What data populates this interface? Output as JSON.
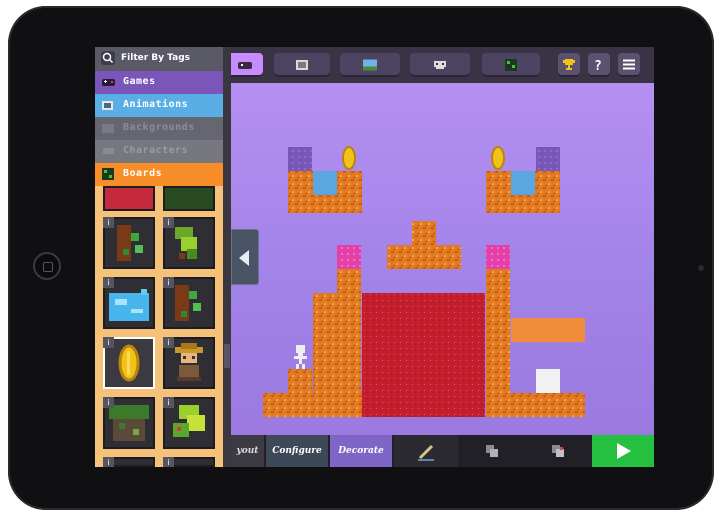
{
  "filter": {
    "label": "Filter By Tags"
  },
  "categories": [
    {
      "label": "Games",
      "icon": "gamepad-icon"
    },
    {
      "label": "Animations",
      "icon": "film-icon"
    },
    {
      "label": "Backgrounds",
      "icon": "landscape-icon"
    },
    {
      "label": "Characters",
      "icon": "character-icon"
    },
    {
      "label": "Boards",
      "icon": "board-icon"
    }
  ],
  "toolbar": {
    "buttons": [
      "games-icon",
      "animations-icon",
      "backgrounds-icon",
      "characters-icon",
      "boards-icon",
      "trophy-icon",
      "help-icon",
      "menu-icon"
    ]
  },
  "bottom_tabs": {
    "layout": "yout",
    "configure": "Configure",
    "decorate": "Decorate"
  },
  "colors": {
    "canvas": "#b68ff2",
    "brick": "#e07a22",
    "lava": "#c4202e",
    "pink": "#e040a8",
    "blue": "#5aa6e0",
    "purple": "#7a56b8",
    "gold": "#f2c21a"
  }
}
